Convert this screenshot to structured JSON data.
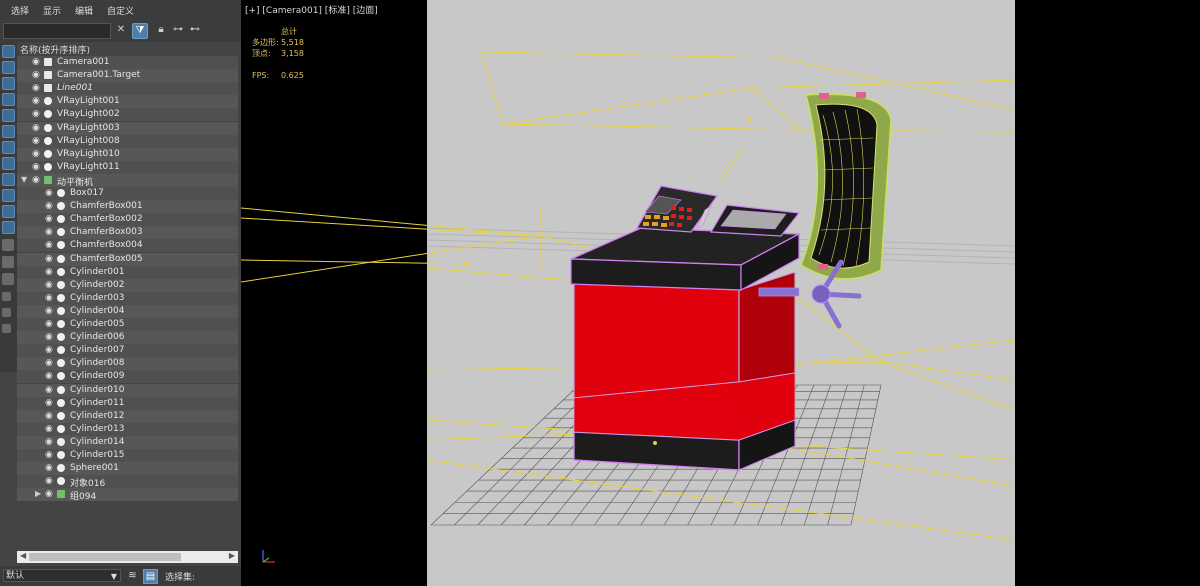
{
  "menu": [
    "选择",
    "显示",
    "编辑",
    "自定义"
  ],
  "explorer": {
    "column_header": "名称(按升序排序)",
    "tree": [
      {
        "label": "Camera001",
        "icon": "camera-icon",
        "level": 0
      },
      {
        "label": "Camera001.Target",
        "icon": "camera-icon",
        "level": 0
      },
      {
        "label": "Line001",
        "icon": "shape-icon",
        "level": 0,
        "italic": true
      },
      {
        "label": "VRayLight001",
        "icon": "light-icon",
        "level": 0
      },
      {
        "label": "VRayLight002",
        "icon": "light-icon",
        "level": 0
      },
      {
        "label": "VRayLight003",
        "icon": "light-icon",
        "level": 0
      },
      {
        "label": "VRayLight008",
        "icon": "light-icon",
        "level": 0
      },
      {
        "label": "VRayLight010",
        "icon": "light-icon",
        "level": 0
      },
      {
        "label": "VRayLight011",
        "icon": "light-icon",
        "level": 0
      },
      {
        "label": "动平衡机",
        "icon": "group-icon",
        "level": 0,
        "expanded": true
      },
      {
        "label": "Box017",
        "icon": "geometry-icon",
        "level": 1
      },
      {
        "label": "ChamferBox001",
        "icon": "geometry-icon",
        "level": 1
      },
      {
        "label": "ChamferBox002",
        "icon": "geometry-icon",
        "level": 1
      },
      {
        "label": "ChamferBox003",
        "icon": "geometry-icon",
        "level": 1
      },
      {
        "label": "ChamferBox004",
        "icon": "geometry-icon",
        "level": 1
      },
      {
        "label": "ChamferBox005",
        "icon": "geometry-icon",
        "level": 1
      },
      {
        "label": "Cylinder001",
        "icon": "geometry-icon",
        "level": 1
      },
      {
        "label": "Cylinder002",
        "icon": "geometry-icon",
        "level": 1
      },
      {
        "label": "Cylinder003",
        "icon": "geometry-icon",
        "level": 1
      },
      {
        "label": "Cylinder004",
        "icon": "geometry-icon",
        "level": 1
      },
      {
        "label": "Cylinder005",
        "icon": "geometry-icon",
        "level": 1
      },
      {
        "label": "Cylinder006",
        "icon": "geometry-icon",
        "level": 1
      },
      {
        "label": "Cylinder007",
        "icon": "geometry-icon",
        "level": 1
      },
      {
        "label": "Cylinder008",
        "icon": "geometry-icon",
        "level": 1
      },
      {
        "label": "Cylinder009",
        "icon": "geometry-icon",
        "level": 1
      },
      {
        "label": "Cylinder010",
        "icon": "geometry-icon",
        "level": 1
      },
      {
        "label": "Cylinder011",
        "icon": "geometry-icon",
        "level": 1
      },
      {
        "label": "Cylinder012",
        "icon": "geometry-icon",
        "level": 1
      },
      {
        "label": "Cylinder013",
        "icon": "geometry-icon",
        "level": 1
      },
      {
        "label": "Cylinder014",
        "icon": "geometry-icon",
        "level": 1
      },
      {
        "label": "Cylinder015",
        "icon": "geometry-icon",
        "level": 1
      },
      {
        "label": "Sphere001",
        "icon": "geometry-icon",
        "level": 1
      },
      {
        "label": "对象016",
        "icon": "geometry-icon",
        "level": 1
      },
      {
        "label": "组094",
        "icon": "group-icon",
        "level": 1,
        "collapsed": true
      }
    ],
    "layer_value": "默认",
    "selection_set_label": "选择集:"
  },
  "viewport": {
    "label": "[+] [Camera001] [标准] [边面]",
    "stats": {
      "total_label": "总计",
      "polys_label": "多边形:",
      "polys_value": "5,518",
      "verts_label": "顶点:",
      "verts_value": "3,158",
      "fps_label": "FPS:",
      "fps_value": "0.625"
    }
  },
  "colors": {
    "selection_wire": "#e0b0ff",
    "light_wire": "#e6d23c",
    "machine_body": "#e0000e",
    "viewport_bg": "#c8c8c8"
  }
}
